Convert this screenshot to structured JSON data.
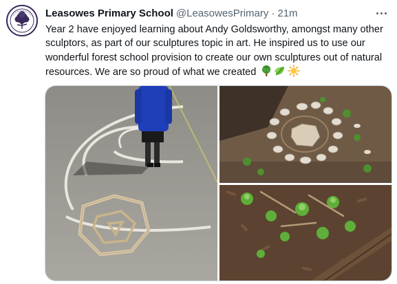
{
  "tweet": {
    "display_name": "Leasowes Primary School",
    "handle": "@LeasowesPrimary",
    "separator": "·",
    "time": "21m",
    "text": "Year 2 have enjoyed learning about Andy Goldsworthy, amongst many other sculptors, as part of our sculptures topic in art. He inspired us to use our wonderful forest school provision to create our own sculptures out of natural resources. We are so proud of what we created",
    "emojis": [
      "deciduous-tree-icon",
      "leaves-icon",
      "sun-icon"
    ]
  },
  "media": {
    "photos": [
      {
        "name": "photo-playground-sculpture"
      },
      {
        "name": "photo-stone-spiral"
      },
      {
        "name": "photo-woodchip-sculpture"
      }
    ]
  },
  "colors": {
    "text": "#0f1419",
    "secondary": "#536471",
    "border": "#cfd9de"
  }
}
